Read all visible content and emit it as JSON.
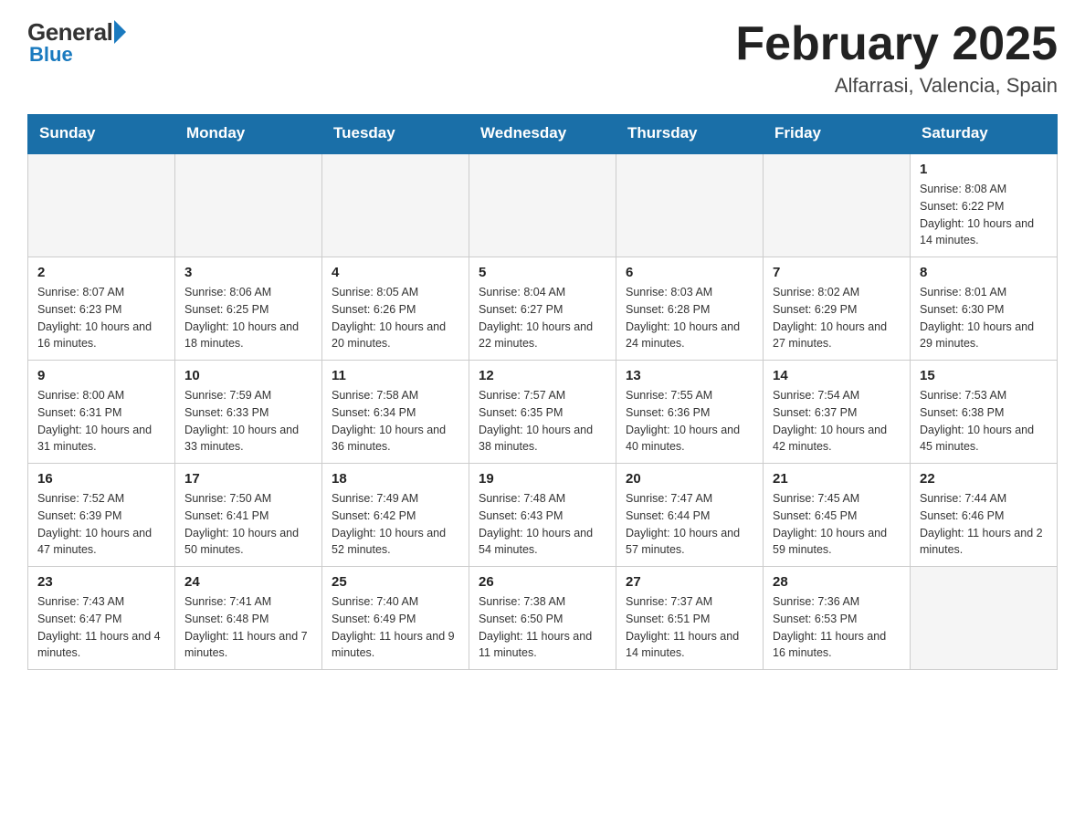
{
  "logo": {
    "general": "General",
    "blue": "Blue"
  },
  "header": {
    "month": "February 2025",
    "location": "Alfarrasi, Valencia, Spain"
  },
  "weekdays": [
    "Sunday",
    "Monday",
    "Tuesday",
    "Wednesday",
    "Thursday",
    "Friday",
    "Saturday"
  ],
  "weeks": [
    [
      {
        "day": "",
        "info": ""
      },
      {
        "day": "",
        "info": ""
      },
      {
        "day": "",
        "info": ""
      },
      {
        "day": "",
        "info": ""
      },
      {
        "day": "",
        "info": ""
      },
      {
        "day": "",
        "info": ""
      },
      {
        "day": "1",
        "info": "Sunrise: 8:08 AM\nSunset: 6:22 PM\nDaylight: 10 hours and 14 minutes."
      }
    ],
    [
      {
        "day": "2",
        "info": "Sunrise: 8:07 AM\nSunset: 6:23 PM\nDaylight: 10 hours and 16 minutes."
      },
      {
        "day": "3",
        "info": "Sunrise: 8:06 AM\nSunset: 6:25 PM\nDaylight: 10 hours and 18 minutes."
      },
      {
        "day": "4",
        "info": "Sunrise: 8:05 AM\nSunset: 6:26 PM\nDaylight: 10 hours and 20 minutes."
      },
      {
        "day": "5",
        "info": "Sunrise: 8:04 AM\nSunset: 6:27 PM\nDaylight: 10 hours and 22 minutes."
      },
      {
        "day": "6",
        "info": "Sunrise: 8:03 AM\nSunset: 6:28 PM\nDaylight: 10 hours and 24 minutes."
      },
      {
        "day": "7",
        "info": "Sunrise: 8:02 AM\nSunset: 6:29 PM\nDaylight: 10 hours and 27 minutes."
      },
      {
        "day": "8",
        "info": "Sunrise: 8:01 AM\nSunset: 6:30 PM\nDaylight: 10 hours and 29 minutes."
      }
    ],
    [
      {
        "day": "9",
        "info": "Sunrise: 8:00 AM\nSunset: 6:31 PM\nDaylight: 10 hours and 31 minutes."
      },
      {
        "day": "10",
        "info": "Sunrise: 7:59 AM\nSunset: 6:33 PM\nDaylight: 10 hours and 33 minutes."
      },
      {
        "day": "11",
        "info": "Sunrise: 7:58 AM\nSunset: 6:34 PM\nDaylight: 10 hours and 36 minutes."
      },
      {
        "day": "12",
        "info": "Sunrise: 7:57 AM\nSunset: 6:35 PM\nDaylight: 10 hours and 38 minutes."
      },
      {
        "day": "13",
        "info": "Sunrise: 7:55 AM\nSunset: 6:36 PM\nDaylight: 10 hours and 40 minutes."
      },
      {
        "day": "14",
        "info": "Sunrise: 7:54 AM\nSunset: 6:37 PM\nDaylight: 10 hours and 42 minutes."
      },
      {
        "day": "15",
        "info": "Sunrise: 7:53 AM\nSunset: 6:38 PM\nDaylight: 10 hours and 45 minutes."
      }
    ],
    [
      {
        "day": "16",
        "info": "Sunrise: 7:52 AM\nSunset: 6:39 PM\nDaylight: 10 hours and 47 minutes."
      },
      {
        "day": "17",
        "info": "Sunrise: 7:50 AM\nSunset: 6:41 PM\nDaylight: 10 hours and 50 minutes."
      },
      {
        "day": "18",
        "info": "Sunrise: 7:49 AM\nSunset: 6:42 PM\nDaylight: 10 hours and 52 minutes."
      },
      {
        "day": "19",
        "info": "Sunrise: 7:48 AM\nSunset: 6:43 PM\nDaylight: 10 hours and 54 minutes."
      },
      {
        "day": "20",
        "info": "Sunrise: 7:47 AM\nSunset: 6:44 PM\nDaylight: 10 hours and 57 minutes."
      },
      {
        "day": "21",
        "info": "Sunrise: 7:45 AM\nSunset: 6:45 PM\nDaylight: 10 hours and 59 minutes."
      },
      {
        "day": "22",
        "info": "Sunrise: 7:44 AM\nSunset: 6:46 PM\nDaylight: 11 hours and 2 minutes."
      }
    ],
    [
      {
        "day": "23",
        "info": "Sunrise: 7:43 AM\nSunset: 6:47 PM\nDaylight: 11 hours and 4 minutes."
      },
      {
        "day": "24",
        "info": "Sunrise: 7:41 AM\nSunset: 6:48 PM\nDaylight: 11 hours and 7 minutes."
      },
      {
        "day": "25",
        "info": "Sunrise: 7:40 AM\nSunset: 6:49 PM\nDaylight: 11 hours and 9 minutes."
      },
      {
        "day": "26",
        "info": "Sunrise: 7:38 AM\nSunset: 6:50 PM\nDaylight: 11 hours and 11 minutes."
      },
      {
        "day": "27",
        "info": "Sunrise: 7:37 AM\nSunset: 6:51 PM\nDaylight: 11 hours and 14 minutes."
      },
      {
        "day": "28",
        "info": "Sunrise: 7:36 AM\nSunset: 6:53 PM\nDaylight: 11 hours and 16 minutes."
      },
      {
        "day": "",
        "info": ""
      }
    ]
  ]
}
